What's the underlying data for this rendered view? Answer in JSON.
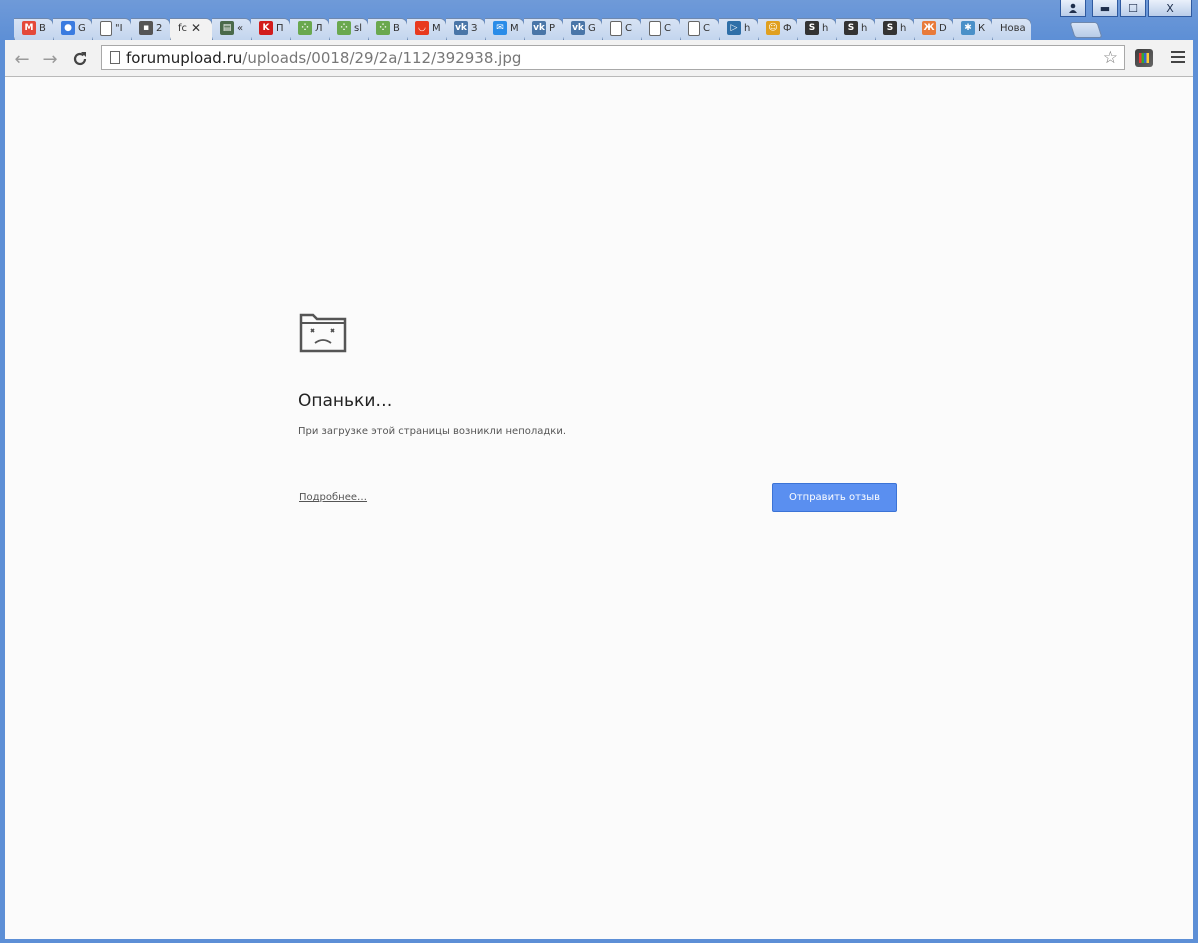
{
  "window": {
    "minimize_glyph": "▬",
    "maximize_glyph": "☐",
    "close_glyph": "X"
  },
  "tabs": [
    {
      "icon": "gmail-icon",
      "icon_char": "M",
      "icon_bg": "#e4493a",
      "title": "В"
    },
    {
      "icon": "contacts-icon",
      "icon_char": "●",
      "icon_bg": "#3a7be0",
      "title": "G"
    },
    {
      "icon": "page-icon",
      "icon_char": "",
      "icon_bg": "",
      "title": "\"I"
    },
    {
      "icon": "app-icon",
      "icon_char": "▪",
      "icon_bg": "#555555",
      "title": "2"
    },
    {
      "icon": "",
      "icon_char": "",
      "icon_bg": "",
      "title": "fc",
      "active": true
    },
    {
      "icon": "news-icon",
      "icon_char": "▤",
      "icon_bg": "#4a6a4a",
      "title": "«"
    },
    {
      "icon": "k-icon",
      "icon_char": "K",
      "icon_bg": "#d21c1c",
      "title": "П"
    },
    {
      "icon": "dots-icon",
      "icon_char": "⁘",
      "icon_bg": "#6aa84f",
      "title": "Л"
    },
    {
      "icon": "dots-icon",
      "icon_char": "⁘",
      "icon_bg": "#6aa84f",
      "title": "sl"
    },
    {
      "icon": "dots-icon",
      "icon_char": "⁘",
      "icon_bg": "#6aa84f",
      "title": "В"
    },
    {
      "icon": "aliexpress-icon",
      "icon_char": "◡",
      "icon_bg": "#e8391e",
      "title": "М"
    },
    {
      "icon": "vk-icon",
      "icon_char": "vk",
      "icon_bg": "#4a76a8",
      "title": "З"
    },
    {
      "icon": "message-icon",
      "icon_char": "✉",
      "icon_bg": "#2a8ce8",
      "title": "М"
    },
    {
      "icon": "vk-icon",
      "icon_char": "vk",
      "icon_bg": "#4a76a8",
      "title": "Р"
    },
    {
      "icon": "vk-icon",
      "icon_char": "vk",
      "icon_bg": "#4a76a8",
      "title": "G"
    },
    {
      "icon": "page-icon",
      "icon_char": "",
      "icon_bg": "",
      "title": "С"
    },
    {
      "icon": "page-icon",
      "icon_char": "",
      "icon_bg": "",
      "title": "С"
    },
    {
      "icon": "page-icon",
      "icon_char": "",
      "icon_bg": "",
      "title": "С"
    },
    {
      "icon": "tv-icon",
      "icon_char": "▷",
      "icon_bg": "#2f6fa8",
      "title": "h"
    },
    {
      "icon": "smiley-icon",
      "icon_char": "☺",
      "icon_bg": "#e0a020",
      "title": "Ф"
    },
    {
      "icon": "s-icon",
      "icon_char": "S",
      "icon_bg": "#333333",
      "title": "h"
    },
    {
      "icon": "s-icon",
      "icon_char": "S",
      "icon_bg": "#333333",
      "title": "h"
    },
    {
      "icon": "s-icon",
      "icon_char": "S",
      "icon_bg": "#333333",
      "title": "h"
    },
    {
      "icon": "ok-icon",
      "icon_char": "Ж",
      "icon_bg": "#e87a3a",
      "title": "D"
    },
    {
      "icon": "puzzle-icon",
      "icon_char": "✱",
      "icon_bg": "#4a90c8",
      "title": "К"
    },
    {
      "icon": "",
      "icon_char": "",
      "icon_bg": "",
      "title": "Нова"
    }
  ],
  "toolbar": {
    "url_host": "forumupload.ru",
    "url_path": "/uploads/0018/29/2a/112/392938.jpg",
    "back_glyph": "←",
    "forward_glyph": "→",
    "reload_glyph": "C",
    "star_glyph": "☆"
  },
  "error": {
    "title": "Опаньки…",
    "description": "При загрузке этой страницы возникли неполадки.",
    "details_link": "Подробнее…",
    "feedback_button": "Отправить отзыв"
  },
  "colors": {
    "frame": "#5d8fd6",
    "feedback_button": "#5a8ff0"
  }
}
